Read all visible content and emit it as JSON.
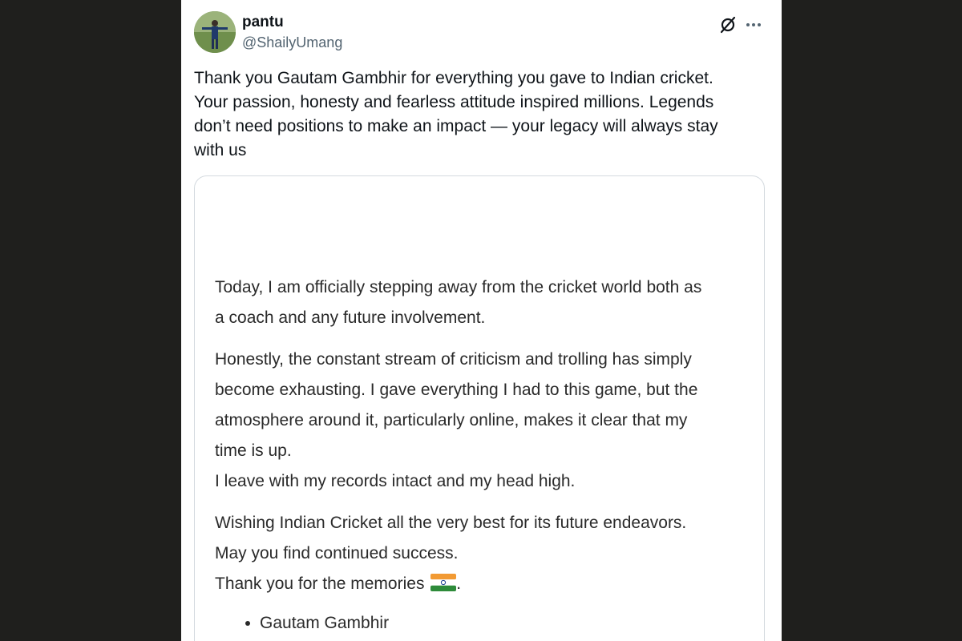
{
  "tweet": {
    "display_name": "pantu",
    "handle": "@ShailyUmang",
    "text": "Thank you Gautam Gambhir  for everything you gave to Indian cricket.\nYour passion, honesty and fearless attitude inspired millions. Legends\ndon’t need positions to make an impact — your legacy will always stay\nwith us",
    "icons": {
      "grok": "grok-icon",
      "more": "more-icon"
    }
  },
  "media": {
    "paragraph_1": "Today, I am officially stepping away from the cricket world both as\na coach and any future involvement.",
    "paragraph_2": "Honestly, the constant stream of criticism and trolling has simply\nbecome exhausting. I gave everything I had to this game, but the\natmosphere around it, particularly online, makes it clear that my\ntime is up.\nI leave with my records intact and my head high.",
    "paragraph_3_lines": "Wishing Indian Cricket all the very best for its future endeavors.\nMay you find continued success.",
    "paragraph_3_last": "Thank you for the memories",
    "paragraph_3_end": ".",
    "signature": "Gautam Gambhir",
    "flag_icon": "india-flag-icon"
  }
}
